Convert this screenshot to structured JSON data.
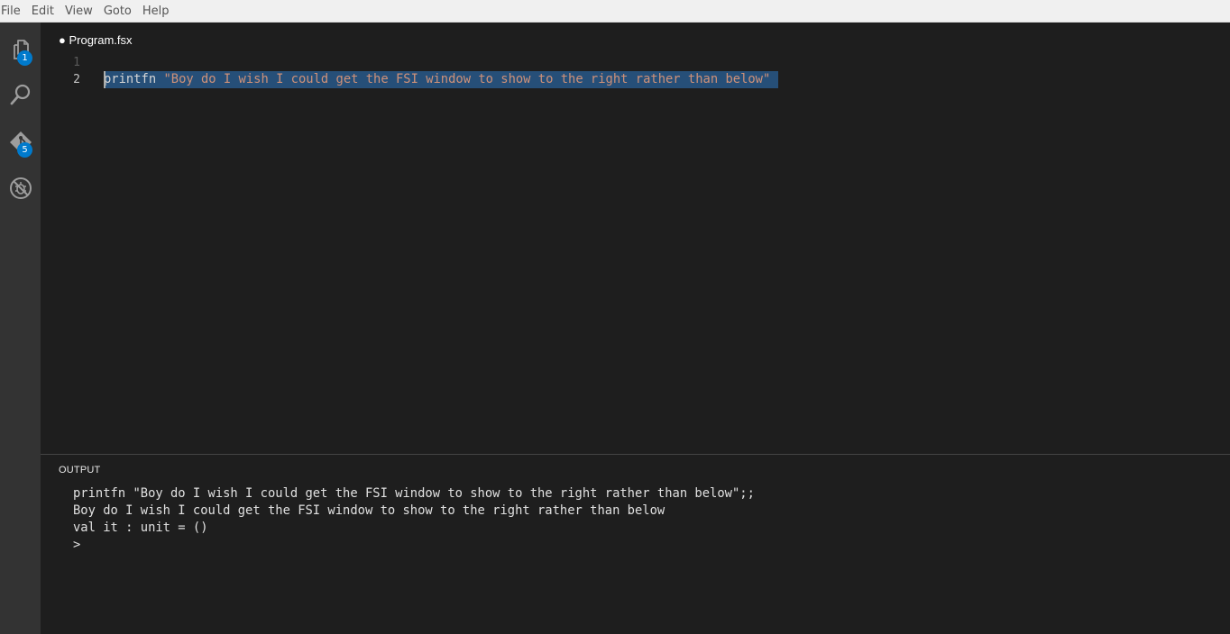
{
  "menu": {
    "items": [
      "File",
      "Edit",
      "View",
      "Goto",
      "Help"
    ]
  },
  "activity_bar": {
    "explorer": {
      "icon": "files-icon",
      "badge": "1"
    },
    "search": {
      "icon": "search-icon"
    },
    "git": {
      "icon": "git-icon",
      "badge": "5"
    },
    "debug": {
      "icon": "debug-icon"
    }
  },
  "editor": {
    "tab_title": "● Program.fsx",
    "line_numbers": [
      "1",
      "2"
    ],
    "lines": [
      {
        "tokens": []
      },
      {
        "tokens": [
          {
            "text": "printfn",
            "type": "keyword"
          },
          {
            "text": " ",
            "type": "plain"
          },
          {
            "text": "\"Boy do I wish I could get the FSI window to show to the right rather than below\"",
            "type": "string"
          }
        ]
      }
    ]
  },
  "output_panel": {
    "title": "OUTPUT",
    "lines": [
      "printfn \"Boy do I wish I could get the FSI window to show to the right rather than below\";;",
      "Boy do I wish I could get the FSI window to show to the right rather than below",
      "val it : unit = ()",
      ">"
    ]
  },
  "colors": {
    "accent": "#007acc",
    "selection": "#264f78",
    "string": "#ce9178",
    "editor_bg": "#1e1e1e",
    "activity_bg": "#333333"
  }
}
